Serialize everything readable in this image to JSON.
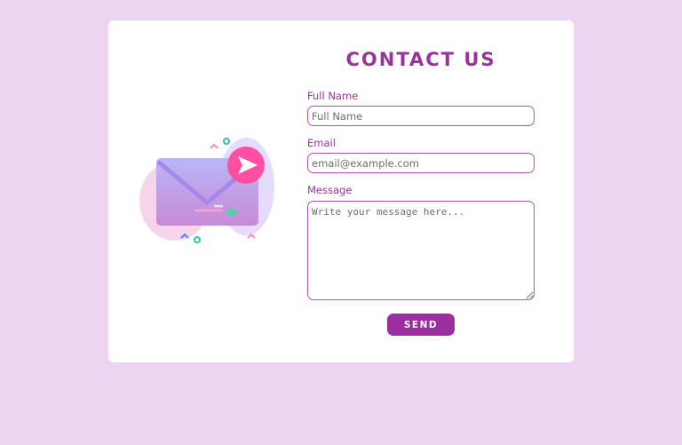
{
  "contact": {
    "title": "CONTACT US",
    "full_name": {
      "label": "Full Name",
      "placeholder": "Full Name"
    },
    "email": {
      "label": "Email",
      "placeholder": "email@example.com"
    },
    "message": {
      "label": "Message",
      "placeholder": "Write your message here..."
    },
    "send_label": "SEND"
  },
  "illustration": {
    "icon": "envelope-send-icon"
  },
  "colors": {
    "background": "#ecd5f0",
    "card": "#ffffff",
    "accent": "#993399",
    "button": "#9b2f9f",
    "send_badge": "#ff4fa0"
  }
}
